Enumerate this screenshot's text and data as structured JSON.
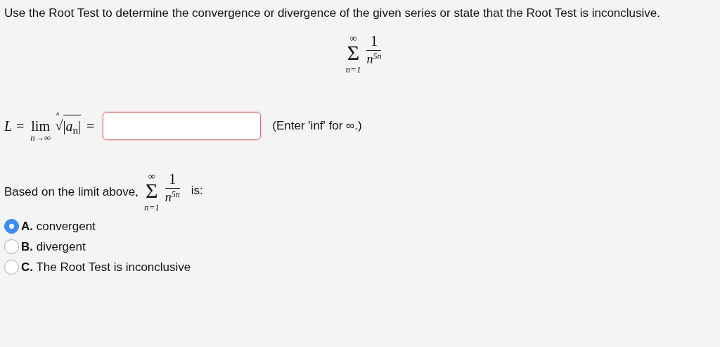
{
  "instruction": "Use the Root Test to determine the convergence or divergence of the given series or state that the Root Test is inconclusive.",
  "series": {
    "sigma": "Σ",
    "upper": "∞",
    "lower": "n=1",
    "numerator": "1",
    "base": "n",
    "exponent": "5n"
  },
  "limit": {
    "lhs": "L =",
    "lim": "lim",
    "under": "n→∞",
    "root_index": "n",
    "radical": "√",
    "radicand": "|*a*$_{n}$|",
    "equals": "=",
    "answer": {
      "invalid": true
    },
    "hint": "(Enter 'inf' for ∞.)"
  },
  "question": {
    "prefix": "Based on the limit above,",
    "series": {
      "sigma": "Σ",
      "upper": "∞",
      "lower": "n=1",
      "numerator": "1",
      "base": "n",
      "exponent": "5n"
    },
    "suffix": "is:"
  },
  "options": [
    {
      "label": "**A.** convergent",
      "selected": true
    },
    {
      "label": "**B.** divergent",
      "selected": false
    },
    {
      "label": "**C.** The Root Test is inconclusive",
      "selected": false
    }
  ]
}
